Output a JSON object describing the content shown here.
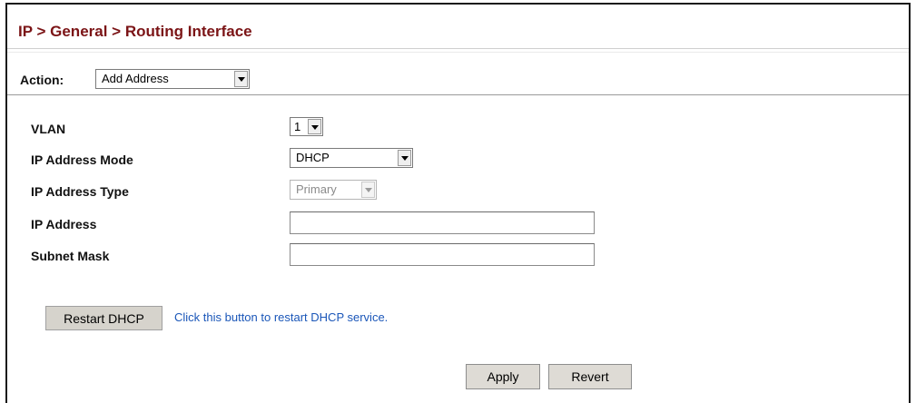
{
  "breadcrumb": "IP > General > Routing Interface",
  "action": {
    "label": "Action:",
    "value": "Add Address"
  },
  "form": {
    "vlan": {
      "label": "VLAN",
      "value": "1"
    },
    "ip_address_mode": {
      "label": "IP Address Mode",
      "value": "DHCP"
    },
    "ip_address_type": {
      "label": "IP Address Type",
      "value": "Primary"
    },
    "ip_address": {
      "label": "IP Address",
      "value": ""
    },
    "subnet_mask": {
      "label": "Subnet Mask",
      "value": ""
    }
  },
  "restart": {
    "button": "Restart DHCP",
    "hint": "Click this button to restart DHCP service."
  },
  "buttons": {
    "apply": "Apply",
    "revert": "Revert"
  }
}
